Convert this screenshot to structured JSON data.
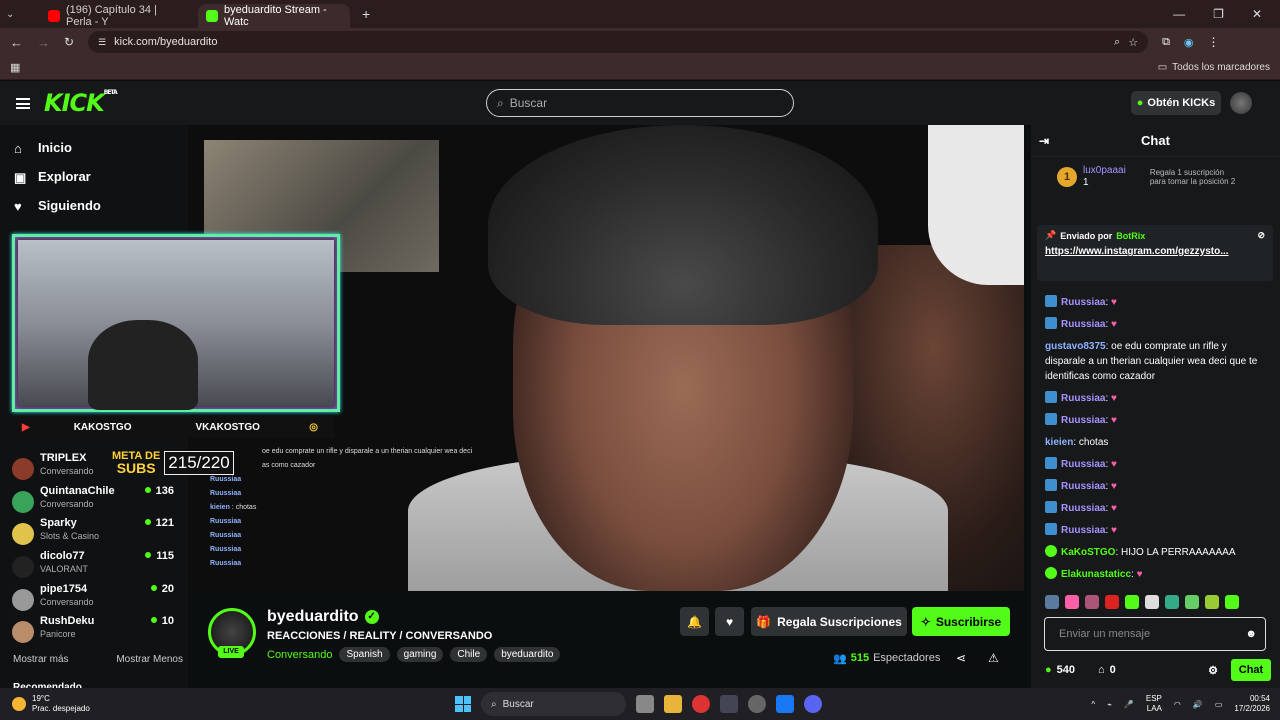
{
  "browser": {
    "tabs": [
      {
        "label": "(196) Capítulo 34 | Perla - Y",
        "favicon_color": "#ff0000"
      },
      {
        "label": "byeduardito Stream - Watc",
        "favicon_color": "#53fc18"
      }
    ],
    "new_tab": "+",
    "url": "kick.com/byeduardito",
    "bookmarks_label": "Todos los marcadores"
  },
  "kick": {
    "logo": "KICK",
    "logo_sup": "BETA",
    "search_placeholder": "Buscar",
    "kicks_button": "Obtén KICKs",
    "accent": "#53fc18"
  },
  "sidebar": {
    "nav": [
      {
        "label": "Inicio",
        "icon": "home-icon"
      },
      {
        "label": "Explorar",
        "icon": "explore-icon"
      },
      {
        "label": "Siguiendo",
        "icon": "heart-icon"
      }
    ],
    "channels": [
      {
        "name": "TRIPLEX",
        "category": "Conversando",
        "viewers": ""
      },
      {
        "name": "QuintanaChile",
        "category": "Conversando",
        "viewers": "136"
      },
      {
        "name": "Sparky",
        "category": "Slots & Casino",
        "viewers": "121"
      },
      {
        "name": "dicolo77",
        "category": "VALORANT",
        "viewers": "115"
      },
      {
        "name": "pipe1754",
        "category": "Conversando",
        "viewers": "20"
      },
      {
        "name": "RushDeku",
        "category": "Panicore",
        "viewers": "10"
      }
    ],
    "show_more": "Mostrar más",
    "show_less": "Mostrar Menos",
    "recommended": "Recomendado"
  },
  "overlay": {
    "left_social": "KAKOSTGO",
    "right_social": "VKAKOSTGO",
    "subs_label_1": "META DE",
    "subs_label_2": "SUBS",
    "subs_count": "215/220",
    "chat_lines": [
      {
        "user": "",
        "text": "oe edu comprate un rifle y disparale a un therian cualquier wea deci"
      },
      {
        "user": "",
        "text": "as como cazador"
      },
      {
        "user": "Ruussiaa",
        "text": ""
      },
      {
        "user": "Ruussiaa",
        "text": ""
      },
      {
        "user": "kieien",
        "text": "chotas"
      },
      {
        "user": "Ruussiaa",
        "text": ""
      },
      {
        "user": "Ruussiaa",
        "text": ""
      },
      {
        "user": "Ruussiaa",
        "text": ""
      },
      {
        "user": "Ruussiaa",
        "text": ""
      }
    ]
  },
  "stream": {
    "channel": "byeduardito",
    "title": "REACCIONES / REALITY / CONVERSANDO",
    "category": "Conversando",
    "tags": [
      "Spanish",
      "gaming",
      "Chile",
      "byeduardito"
    ],
    "live": "LIVE",
    "gift_button": "Regala Suscripciones",
    "subscribe_button": "Suscribirse",
    "viewers": "515",
    "viewers_label": "Espectadores"
  },
  "chat": {
    "title": "Chat",
    "leader_rank": "1",
    "leader_user": "lux0paaai",
    "leader_count": "1",
    "leader_cta_1": "Regala 1 suscripción",
    "leader_cta_2": "para tomar la posición 2",
    "pinned_by": "Enviado por",
    "pinned_bot": "BotRix",
    "pinned_link": "https://www.instagram.com/gezzysto...",
    "messages": [
      {
        "user": "Ruussiaa",
        "color": "#a693ff",
        "text": "",
        "badge": "b"
      },
      {
        "user": "Ruussiaa",
        "color": "#a693ff",
        "text": "",
        "badge": "b"
      },
      {
        "user": "gustavo8375",
        "color": "#8fb3ff",
        "text": "oe edu comprate un rifle y disparale a un therian cualquier wea deci que te identificas como cazador",
        "badge": ""
      },
      {
        "user": "Ruussiaa",
        "color": "#a693ff",
        "text": "",
        "badge": "b"
      },
      {
        "user": "Ruussiaa",
        "color": "#a693ff",
        "text": "",
        "badge": "b"
      },
      {
        "user": "kieien",
        "color": "#8fb3ff",
        "text": "chotas",
        "badge": ""
      },
      {
        "user": "Ruussiaa",
        "color": "#a693ff",
        "text": "",
        "badge": "b"
      },
      {
        "user": "Ruussiaa",
        "color": "#a693ff",
        "text": "",
        "badge": "b"
      },
      {
        "user": "Ruussiaa",
        "color": "#a693ff",
        "text": "",
        "badge": "b"
      },
      {
        "user": "Ruussiaa",
        "color": "#a693ff",
        "text": "",
        "badge": "b"
      },
      {
        "user": "KaKoSTGO",
        "color": "#53fc18",
        "text": "HIJO LA PERRAAAAAAA",
        "badge": "g"
      },
      {
        "user": "Elakunastaticc",
        "color": "#53fc18",
        "text": "",
        "badge": "g"
      }
    ],
    "input_placeholder": "Enviar un mensaje",
    "kicks_balance": "540",
    "points": "0",
    "send_button": "Chat"
  },
  "taskbar": {
    "temp": "19°C",
    "weather": "Prac. despejado",
    "search": "Buscar",
    "lang_1": "ESP",
    "lang_2": "LAA",
    "time": "00:54",
    "date": "17/2/2026"
  }
}
